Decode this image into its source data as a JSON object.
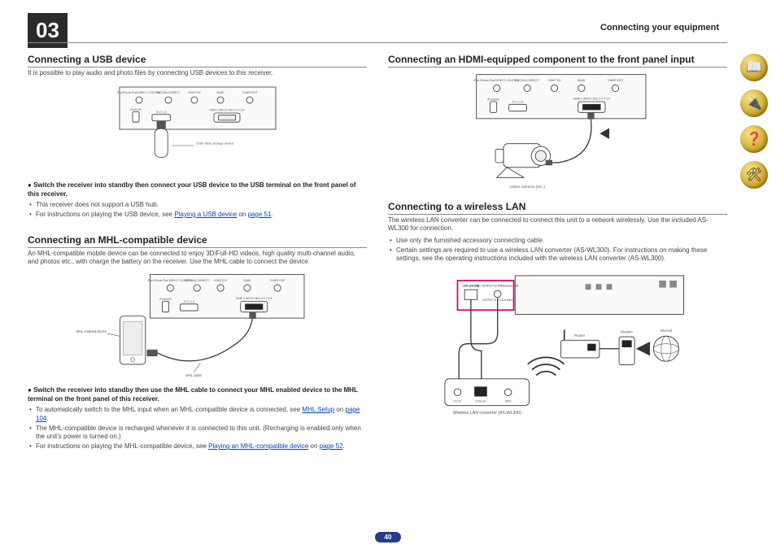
{
  "chapter_number": "03",
  "chapter_title": "Connecting your equipment",
  "page_number": "40",
  "sidebar": {
    "icons": [
      {
        "name": "book-icon",
        "glyph": "📖"
      },
      {
        "name": "equipment-icon",
        "glyph": "🔌"
      },
      {
        "name": "help-icon",
        "glyph": "❓"
      },
      {
        "name": "settings-icon",
        "glyph": "🛠"
      }
    ]
  },
  "left": {
    "usb": {
      "heading": "Connecting a USB device",
      "intro": "It is possible to play audio and photo files by connecting USB devices to this receiver.",
      "diagram": {
        "panel_labels": [
          "iPod iPhone iPad DIRECT CONTROL",
          "AUTO/ALC/DIRECT",
          "HDMI THX",
          "BAND",
          "TUNER EDIT"
        ],
        "ports": [
          "iPod/USB",
          "5 V  2.1 A",
          "HDMI 5 INPUT/ MHL  5 V  0.9 A"
        ],
        "caption": "USB mass storage device"
      },
      "note": "Switch the receiver into standby then connect your USB device to the USB terminal on the front panel of this receiver.",
      "bullets": [
        {
          "text": "This receiver does not support a USB hub."
        },
        {
          "text_before": "For instructions on playing the USB device, see ",
          "link": "Playing a USB device",
          "text_mid": " on ",
          "page_link": "page 51",
          "text_after": "."
        }
      ]
    },
    "mhl": {
      "heading": "Connecting an MHL-compatible device",
      "intro": "An MHL-compatible mobile device can be connected to enjoy 3D/Full-HD videos, high quality multi-channel audio, and photos etc., with charge the battery on the receiver. Use the MHL cable to connect the device.",
      "diagram": {
        "panel_labels": [
          "iPod iPhone iPad DIRECT CONTROL",
          "AUTO/ALC/DIRECT",
          "HDMI THX",
          "BAND",
          "TUNER EDIT"
        ],
        "ports": [
          "iPod/USB",
          "5 V  2.1 A",
          "HDMI 5 INPUT/ MHL  5 V  0.9 A"
        ],
        "left_caption": "MHL enabled device",
        "cable_caption": "MHL cable"
      },
      "note": "Switch the receiver into standby then use the MHL cable to connect your MHL enabled device to the MHL terminal on the front panel of this receiver.",
      "bullets": [
        {
          "text_before": "To automatically switch to the MHL input when an MHL-compatible device is connected, see ",
          "link": "MHL Setup",
          "text_mid": " on ",
          "page_link": "page 104",
          "text_after": "."
        },
        {
          "text": "The MHL-compatible device is recharged whenever it is connected to this unit. (Recharging is enabled only when the unit's power is turned on.)"
        },
        {
          "text_before": "For instructions on playing the MHL-compatible device, see ",
          "link": "Playing an MHL-compatible device",
          "text_mid": " on ",
          "page_link": "page 52",
          "text_after": "."
        }
      ]
    }
  },
  "right": {
    "hdmi": {
      "heading": "Connecting an HDMI-equipped component to the front panel input",
      "diagram": {
        "panel_labels": [
          "iPod iPhone iPad DIRECT CONTROL",
          "AUTO/ALC/DIRECT",
          "HDMI THX",
          "BAND",
          "TUNER EDIT"
        ],
        "ports": [
          "iPod/USB",
          "5 V  2.1 A",
          "HDMI 5 INPUT/ MHL  5 V  0.9 A"
        ],
        "caption": "Video camera (etc.)"
      }
    },
    "wlan": {
      "heading": "Connecting to a wireless LAN",
      "intro": "The wireless LAN converter can be connected to connect this unit to a network wirelessly. Use the included AS-WL300 for connection.",
      "bullets": [
        {
          "text": "Use only the furnished accessory connecting cable."
        },
        {
          "text": "Certain settings are required to use a wireless LAN converter (AS-WL300). For instructions on making these settings, see the operating instructions included with the wireless LAN converter (AS-WL300)."
        }
      ],
      "diagram": {
        "rear_labels": [
          "LAN (10/100)",
          "DC OUTPUT for WIRELESS LAN",
          "OUTPUT 5 V 0.6 A MAX"
        ],
        "router_label": "Router",
        "modem_label": "Modem",
        "internet_label": "Internet",
        "converter_ports": [
          "DC 5V",
          "Ethernet",
          "WPS"
        ],
        "caption": "Wireless LAN converter (AS-WL300)"
      }
    }
  }
}
